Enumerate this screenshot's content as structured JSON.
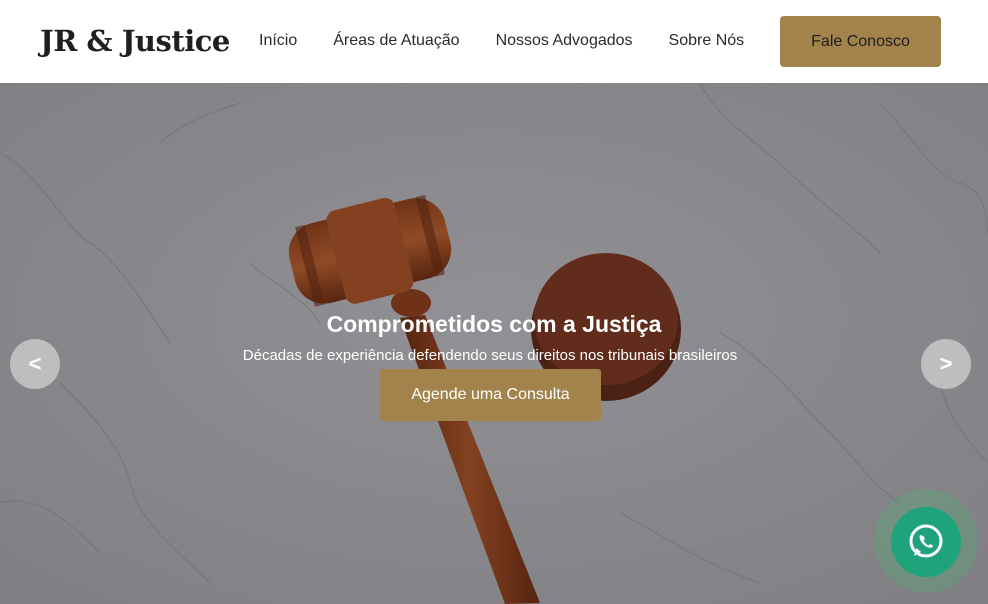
{
  "header": {
    "logo": "JR & Justice",
    "nav": [
      {
        "label": "Início"
      },
      {
        "label": "Áreas de Atuação"
      },
      {
        "label": "Nossos Advogados"
      },
      {
        "label": "Sobre Nós"
      }
    ],
    "cta_label": "Fale Conosco",
    "accent_color": "#a2834c"
  },
  "hero": {
    "title": "Comprometidos com a Justiça",
    "subtitle": "Décadas de experiência defendendo seus direitos nos tribunais brasileiros",
    "button_label": "Agende uma Consulta",
    "prev_label": "<",
    "next_label": ">",
    "background_image": "gavel-on-marble"
  },
  "whatsapp": {
    "icon": "whatsapp-icon",
    "color": "#1fa37a"
  }
}
